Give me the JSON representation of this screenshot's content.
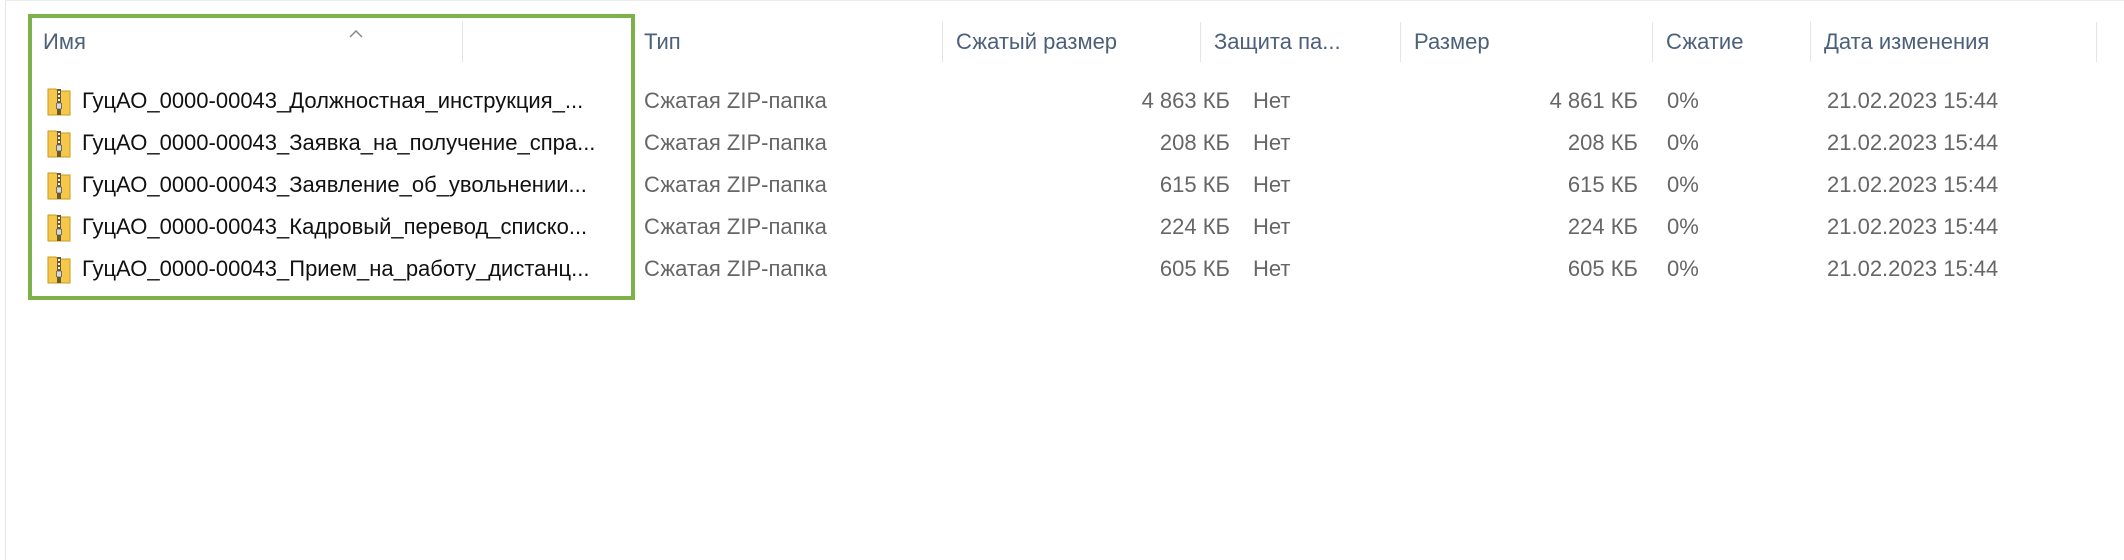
{
  "colors": {
    "header_text": "#4c607a",
    "cell_text": "#666666",
    "name_text": "#111111",
    "highlight_border": "#7db24a",
    "zip_folder": "#f5c84c"
  },
  "columns": {
    "name": "Имя",
    "type": "Тип",
    "compressed_size": "Сжатый размер",
    "password_protected": "Защита па...",
    "size": "Размер",
    "ratio": "Сжатие",
    "modified": "Дата изменения"
  },
  "sort": {
    "column": "name",
    "direction": "ascending",
    "icon": "sort-up-chevron-icon"
  },
  "files": [
    {
      "icon": "zip-folder-icon",
      "name": "ГуцАО_0000-00043_Должностная_инструкция_...",
      "type": "Сжатая ZIP-папка",
      "compressed_size": "4 863 КБ",
      "password_protected": "Нет",
      "size": "4 861 КБ",
      "ratio": "0%",
      "modified": "21.02.2023 15:44"
    },
    {
      "icon": "zip-folder-icon",
      "name": "ГуцАО_0000-00043_Заявка_на_получение_спра...",
      "type": "Сжатая ZIP-папка",
      "compressed_size": "208 КБ",
      "password_protected": "Нет",
      "size": "208 КБ",
      "ratio": "0%",
      "modified": "21.02.2023 15:44"
    },
    {
      "icon": "zip-folder-icon",
      "name": "ГуцАО_0000-00043_Заявление_об_увольнении...",
      "type": "Сжатая ZIP-папка",
      "compressed_size": "615 КБ",
      "password_protected": "Нет",
      "size": "615 КБ",
      "ratio": "0%",
      "modified": "21.02.2023 15:44"
    },
    {
      "icon": "zip-folder-icon",
      "name": "ГуцАО_0000-00043_Кадровый_перевод_списко...",
      "type": "Сжатая ZIP-папка",
      "compressed_size": "224 КБ",
      "password_protected": "Нет",
      "size": "224 КБ",
      "ratio": "0%",
      "modified": "21.02.2023 15:44"
    },
    {
      "icon": "zip-folder-icon",
      "name": "ГуцАО_0000-00043_Прием_на_работу_дистанц...",
      "type": "Сжатая ZIP-папка",
      "compressed_size": "605 КБ",
      "password_protected": "Нет",
      "size": "605 КБ",
      "ratio": "0%",
      "modified": "21.02.2023 15:44"
    }
  ]
}
